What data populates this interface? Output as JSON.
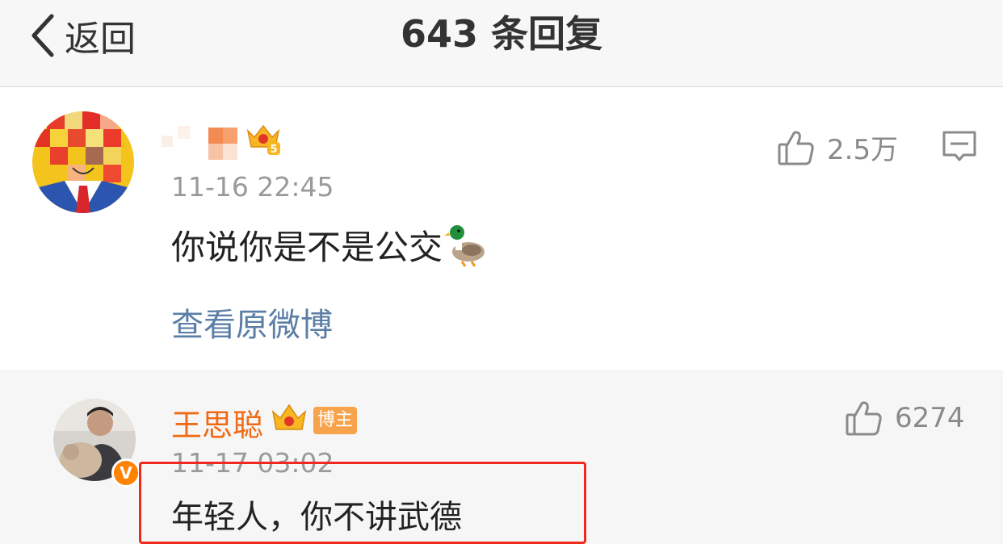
{
  "header": {
    "back_label": "返回",
    "title": "643 条回复"
  },
  "post": {
    "time": "11-16 22:45",
    "text": "你说你是不是公交",
    "emoji_icon": "duck-emoji",
    "view_original": "查看原微博",
    "likes": "2.5万"
  },
  "reply": {
    "name": "王思聪",
    "badge": "博主",
    "verified_mark": "V",
    "time": "11-17 03:02",
    "text": "年轻人，你不讲武德",
    "likes": "6274"
  },
  "colors": {
    "username_orange": "#f06a13",
    "link_blue": "#5a7ea5",
    "highlight_red": "#f0281e",
    "verified_orange": "#ff8200"
  }
}
